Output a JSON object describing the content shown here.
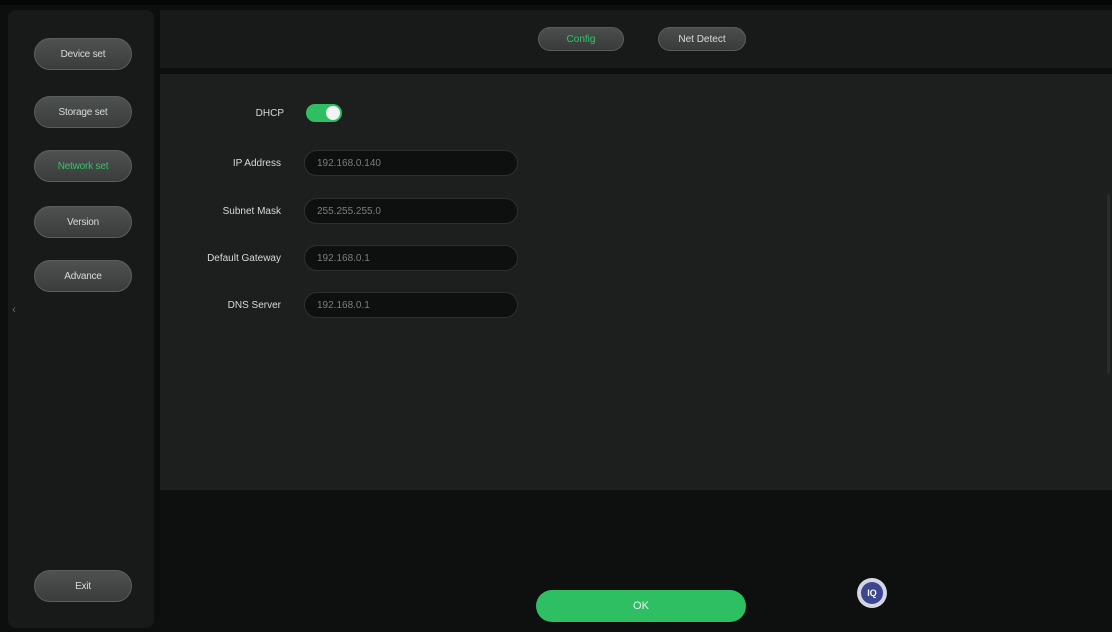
{
  "sidebar": {
    "items": [
      {
        "label": "Device set",
        "active": false
      },
      {
        "label": "Storage set",
        "active": false
      },
      {
        "label": "Network set",
        "active": true
      },
      {
        "label": "Version",
        "active": false
      },
      {
        "label": "Advance",
        "active": false
      }
    ],
    "exit_label": "Exit",
    "collapse_icon": "chevron-left-icon"
  },
  "tabs": [
    {
      "label": "Config",
      "active": true
    },
    {
      "label": "Net Detect",
      "active": false
    }
  ],
  "network": {
    "dhcp_label": "DHCP",
    "dhcp_enabled": true,
    "ip_label": "IP Address",
    "ip_value": "192.168.0.140",
    "mask_label": "Subnet Mask",
    "mask_value": "255.255.255.0",
    "gateway_label": "Default Gateway",
    "gateway_value": "192.168.0.1",
    "dns_label": "DNS Server",
    "dns_value": "192.168.0.1"
  },
  "footer": {
    "ok_label": "OK",
    "iq_label": "IQ"
  },
  "colors": {
    "accent": "#2fbf63",
    "background": "#0d0e0e",
    "panel": "#1c1f1e",
    "button": "#434745"
  }
}
